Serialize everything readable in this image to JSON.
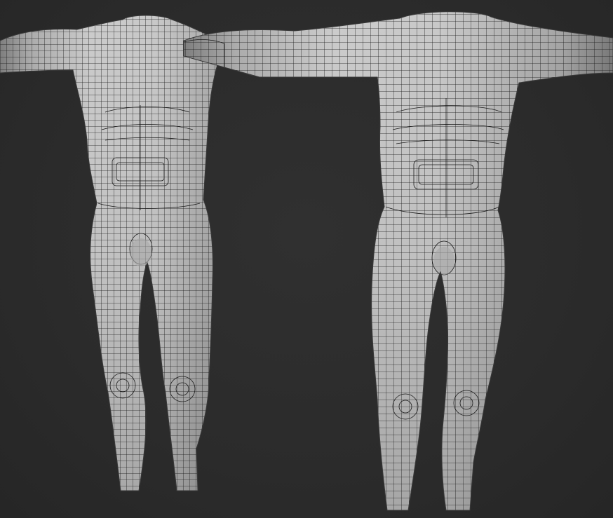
{
  "scene": {
    "background_color": "#2c2c2c",
    "surface_color": "#b9b9b9",
    "wire_color": "#1a1a1a",
    "models": [
      {
        "id": "left",
        "label": ""
      },
      {
        "id": "right",
        "label": ""
      }
    ]
  }
}
